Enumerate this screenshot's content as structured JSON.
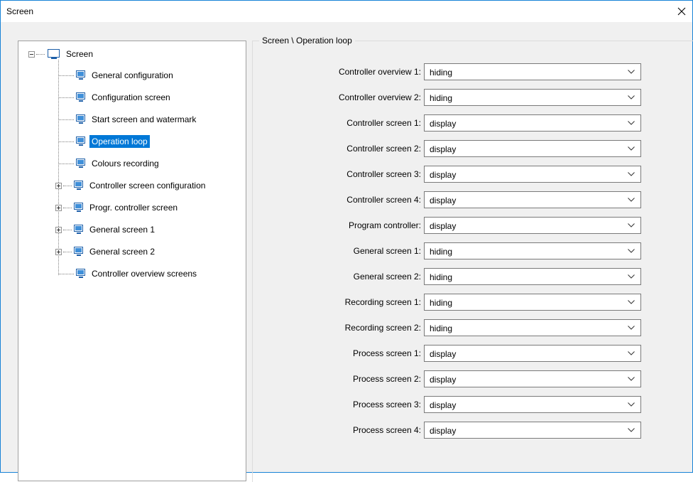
{
  "window": {
    "title": "Screen"
  },
  "tree": {
    "root": {
      "label": "Screen",
      "icon": "monitor-icon"
    },
    "items": [
      {
        "label": "General configuration",
        "icon": "gear-monitor-icon",
        "expandable": false,
        "selected": false
      },
      {
        "label": "Configuration screen",
        "icon": "grid-monitor-icon",
        "expandable": false,
        "selected": false
      },
      {
        "label": "Start screen and watermark",
        "icon": "picture-monitor-icon",
        "expandable": false,
        "selected": false
      },
      {
        "label": "Operation loop",
        "icon": "loop-monitor-icon",
        "expandable": false,
        "selected": true
      },
      {
        "label": "Colours recording",
        "icon": "palette-monitor-icon",
        "expandable": false,
        "selected": false
      },
      {
        "label": "Controller screen configuration",
        "icon": "controller-monitor-icon",
        "expandable": true,
        "selected": false
      },
      {
        "label": "Progr. controller screen",
        "icon": "program-monitor-icon",
        "expandable": true,
        "selected": false
      },
      {
        "label": "General screen 1",
        "icon": "chart-monitor-icon",
        "expandable": true,
        "selected": false
      },
      {
        "label": "General screen 2",
        "icon": "chart-monitor-icon",
        "expandable": true,
        "selected": false
      },
      {
        "label": "Controller overview screens",
        "icon": "overview-monitor-icon",
        "expandable": false,
        "selected": false
      }
    ]
  },
  "group": {
    "title": "Screen \\ Operation loop"
  },
  "settings": [
    {
      "label": "Controller overview 1:",
      "value": "hiding"
    },
    {
      "label": "Controller overview 2:",
      "value": "hiding"
    },
    {
      "label": "Controller screen 1:",
      "value": "display"
    },
    {
      "label": "Controller screen 2:",
      "value": "display"
    },
    {
      "label": "Controller screen 3:",
      "value": "display"
    },
    {
      "label": "Controller screen 4:",
      "value": "display"
    },
    {
      "label": "Program controller:",
      "value": "display"
    },
    {
      "label": "General screen 1:",
      "value": "hiding"
    },
    {
      "label": "General screen 2:",
      "value": "hiding"
    },
    {
      "label": "Recording screen 1:",
      "value": "hiding"
    },
    {
      "label": "Recording screen 2:",
      "value": "hiding"
    },
    {
      "label": "Process screen 1:",
      "value": "display"
    },
    {
      "label": "Process screen 2:",
      "value": "display"
    },
    {
      "label": "Process screen 3:",
      "value": "display"
    },
    {
      "label": "Process screen 4:",
      "value": "display"
    }
  ],
  "colors": {
    "selection": "#0078d7",
    "window_border": "#1883d7",
    "icon_blue": "#1c5ea8"
  }
}
